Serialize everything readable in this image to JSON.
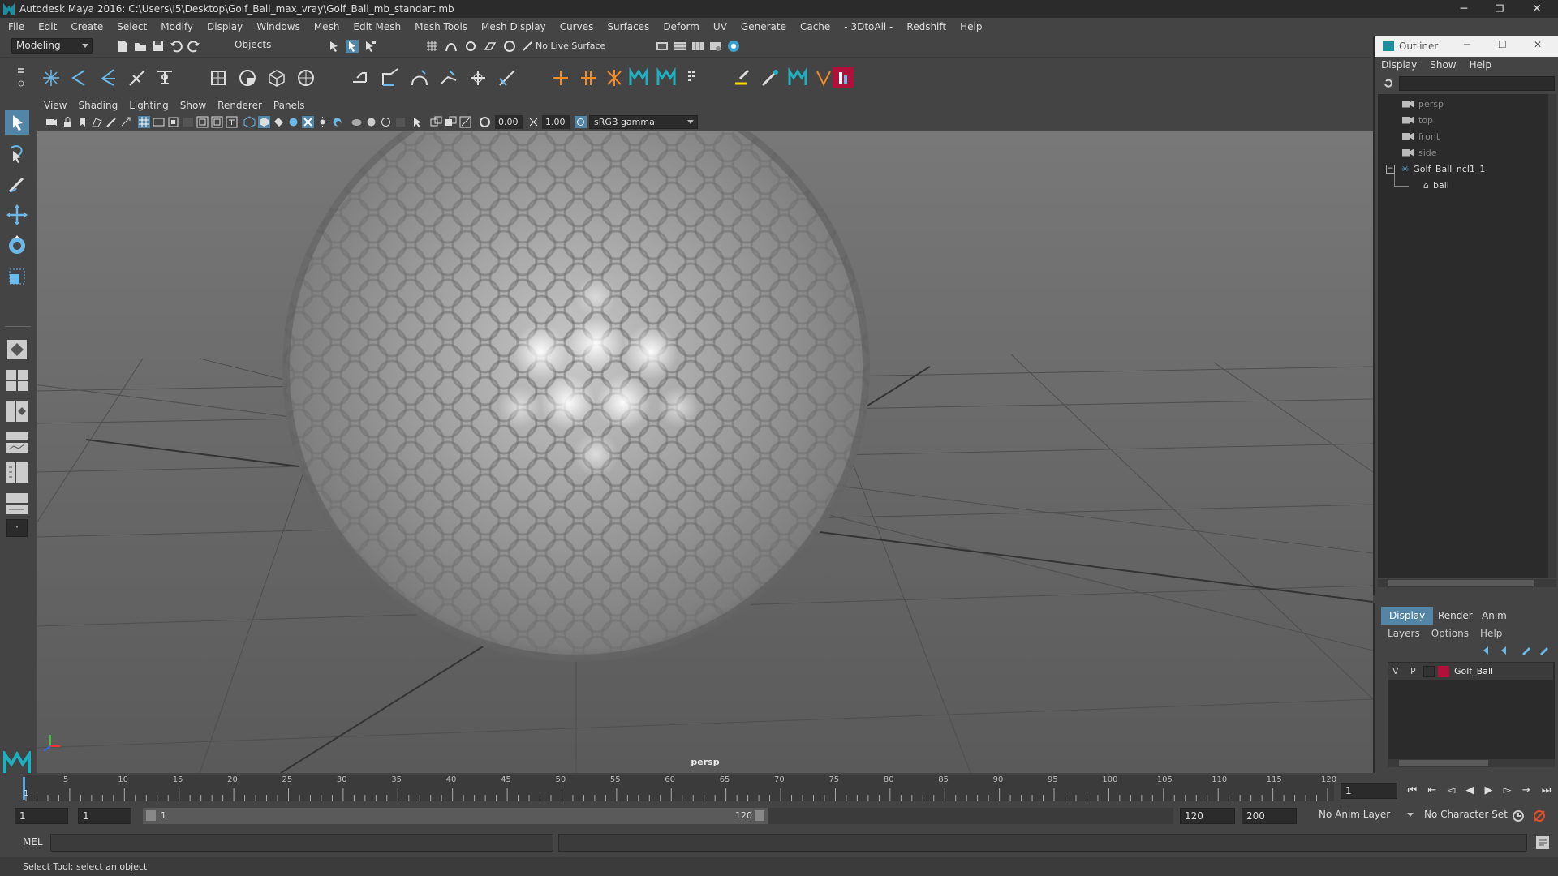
{
  "window": {
    "title": "Autodesk Maya 2016: C:\\Users\\I5\\Desktop\\Golf_Ball_max_vray\\Golf_Ball_mb_standart.mb",
    "minimize": "─",
    "restore": "❐",
    "close": "✕"
  },
  "menubar": [
    "File",
    "Edit",
    "Create",
    "Select",
    "Modify",
    "Display",
    "Windows",
    "Mesh",
    "Edit Mesh",
    "Mesh Tools",
    "Mesh Display",
    "Curves",
    "Surfaces",
    "Deform",
    "UV",
    "Generate",
    "Cache",
    "- 3DtoAll -",
    "Redshift",
    "Help"
  ],
  "status": {
    "menuset": "Modeling",
    "selection_mode": "Objects",
    "live_surface": "No Live Surface"
  },
  "viewport": {
    "menu": [
      "View",
      "Shading",
      "Lighting",
      "Show",
      "Renderer",
      "Panels"
    ],
    "exposure": "0.00",
    "gamma": "1.00",
    "color_space": "sRGB gamma",
    "camera_label": "persp"
  },
  "outliner": {
    "title": "Outliner",
    "menu": [
      "Display",
      "Show",
      "Help"
    ],
    "items": [
      {
        "label": "persp",
        "kind": "camera"
      },
      {
        "label": "top",
        "kind": "camera"
      },
      {
        "label": "front",
        "kind": "camera"
      },
      {
        "label": "side",
        "kind": "camera"
      },
      {
        "label": "Golf_Ball_ncl1_1",
        "kind": "group"
      },
      {
        "label": "ball",
        "kind": "mesh"
      }
    ]
  },
  "layers": {
    "tabs": [
      "Display",
      "Render",
      "Anim"
    ],
    "active_tab": "Display",
    "menu": [
      "Layers",
      "Options",
      "Help"
    ],
    "rows": [
      {
        "v": "V",
        "p": "P",
        "name": "Golf_Ball",
        "color": "#b0103a"
      }
    ]
  },
  "timeline": {
    "ticks": [
      "5",
      "10",
      "15",
      "20",
      "25",
      "30",
      "35",
      "40",
      "45",
      "50",
      "55",
      "60",
      "65",
      "70",
      "75",
      "80",
      "85",
      "90",
      "95",
      "100",
      "105",
      "110",
      "115",
      "120"
    ],
    "start_tick": "1",
    "current_frame": "1",
    "range_start": "1",
    "range_inner_start": "1",
    "range_slider_start": "1",
    "range_slider_end": "120",
    "range_end": "120",
    "anim_end": "200",
    "anim_layer": "No Anim Layer",
    "char_set": "No Character Set"
  },
  "cmdline": {
    "label": "MEL"
  },
  "helpline": "Select Tool: select an object",
  "colors": {
    "accent": "#5285a6",
    "layer": "#b0103a",
    "maya_teal": "#1e8e9e"
  }
}
